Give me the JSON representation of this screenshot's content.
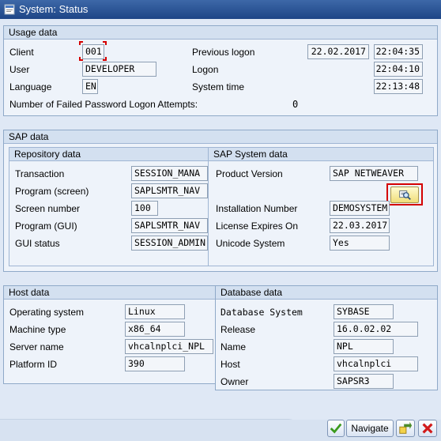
{
  "window": {
    "title": "System: Status"
  },
  "usage": {
    "title": "Usage data",
    "client_label": "Client",
    "client_value": "001",
    "user_label": "User",
    "user_value": "DEVELOPER",
    "language_label": "Language",
    "language_value": "EN",
    "prev_logon_label": "Previous logon",
    "prev_logon_date": "22.02.2017",
    "prev_logon_time": "22:04:35",
    "logon_label": "Logon",
    "logon_time": "22:04:10",
    "system_time_label": "System time",
    "system_time": "22:13:48",
    "failed_label": "Number of Failed Password Logon Attempts:",
    "failed_value": "0"
  },
  "sap": {
    "title": "SAP data",
    "repo": {
      "title": "Repository data",
      "transaction_label": "Transaction",
      "transaction_value": "SESSION_MANA",
      "program_screen_label": "Program (screen)",
      "program_screen_value": "SAPLSMTR_NAV",
      "screen_number_label": "Screen number",
      "screen_number_value": "100",
      "program_gui_label": "Program (GUI)",
      "program_gui_value": "SAPLSMTR_NAV",
      "gui_status_label": "GUI status",
      "gui_status_value": "SESSION_ADMIN"
    },
    "system": {
      "title": "SAP System data",
      "product_version_label": "Product Version",
      "product_version_value": "SAP NETWEAVER",
      "installation_label": "Installation Number",
      "installation_value": "DEMOSYSTEM",
      "license_label": "License Expires On",
      "license_value": "22.03.2017",
      "unicode_label": "Unicode System",
      "unicode_value": "Yes"
    }
  },
  "host": {
    "title": "Host data",
    "os_label": "Operating system",
    "os_value": "Linux",
    "machine_label": "Machine type",
    "machine_value": "x86_64",
    "server_label": "Server name",
    "server_value": "vhcalnplci_NPL",
    "platform_label": "Platform ID",
    "platform_value": "390"
  },
  "database": {
    "title": "Database data",
    "system_label": "Database System",
    "system_value": "SYBASE",
    "release_label": "Release",
    "release_value": "16.0.02.02",
    "name_label": "Name",
    "name_value": "NPL",
    "host_label": "Host",
    "host_value": "vhcalnplci",
    "owner_label": "Owner",
    "owner_value": "SAPSR3"
  },
  "footer": {
    "navigate_label": "Navigate"
  },
  "colors": {
    "titlebar": "#1f4b8e",
    "highlight": "#d40000",
    "group_header": "#d3e0f0"
  }
}
